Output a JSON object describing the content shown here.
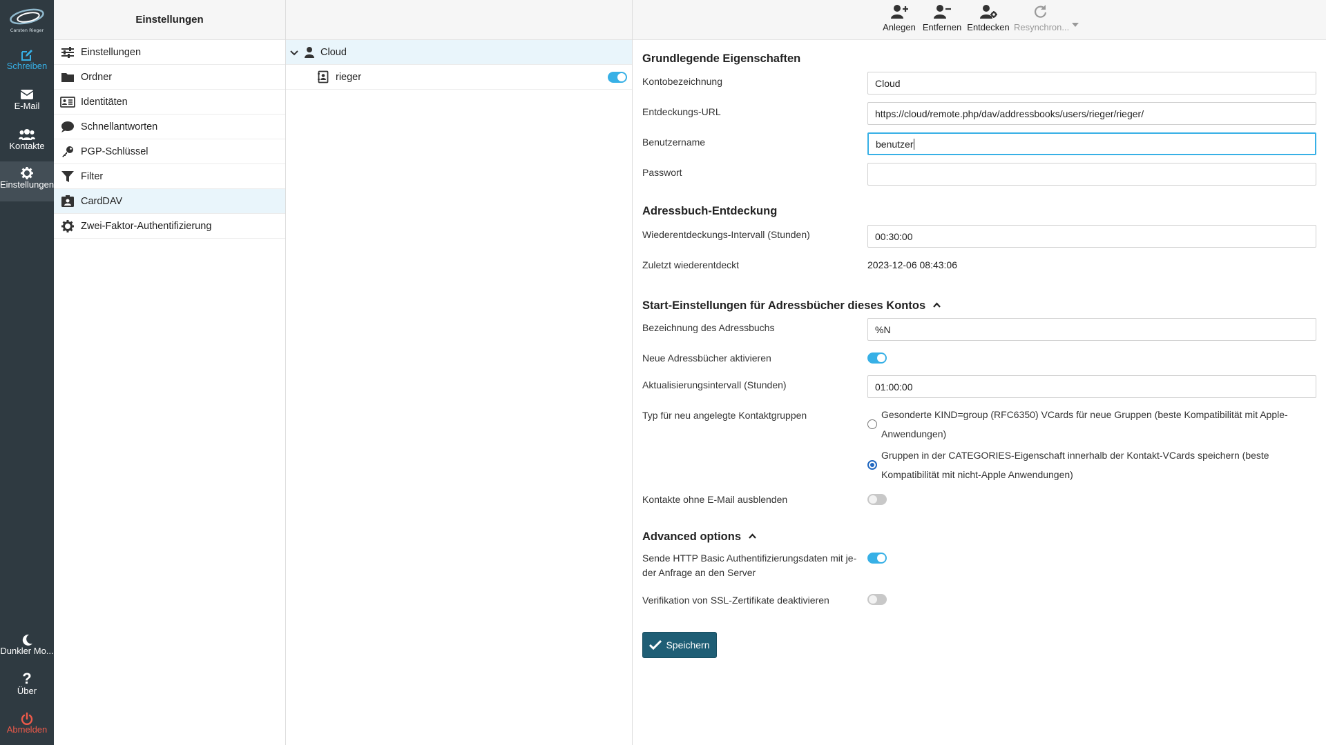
{
  "rail": {
    "logo_text": "Carsten Rieger",
    "compose": "Schreiben",
    "mail": "E-Mail",
    "contacts": "Kontakte",
    "settings": "Einstellungen",
    "dark_mode": "Dunkler Mo...",
    "about": "Über",
    "logout": "Abmelden"
  },
  "settings_nav": {
    "title": "Einstellungen",
    "items": [
      {
        "label": "Einstellungen",
        "icon": "sliders-icon"
      },
      {
        "label": "Ordner",
        "icon": "folder-icon"
      },
      {
        "label": "Identitäten",
        "icon": "id-card-icon"
      },
      {
        "label": "Schnellantworten",
        "icon": "speech-bubble-icon"
      },
      {
        "label": "PGP-Schlüssel",
        "icon": "key-icon"
      },
      {
        "label": "Filter",
        "icon": "filter-icon"
      },
      {
        "label": "CardDAV",
        "icon": "contact-card-icon"
      },
      {
        "label": "Zwei-Faktor-Authentifizierung",
        "icon": "gear-icon"
      }
    ],
    "selected": "CardDAV"
  },
  "accounts": {
    "account_name": "Cloud",
    "addressbook_name": "rieger",
    "addressbook_enabled": true
  },
  "toolbar": {
    "create": "Anlegen",
    "remove": "Entfernen",
    "discover": "Entdecken",
    "resync": "Resynchron..."
  },
  "form": {
    "basic_title": "Grundlegende Eigenschaften",
    "account_label": "Kontobezeichnung",
    "account_value": "Cloud",
    "discovery_label": "Entdeckungs-URL",
    "discovery_value": "https://cloud/remote.php/dav/addressbooks/users/rieger/rieger/",
    "username_label": "Benutzername",
    "username_value": "benutzer",
    "password_label": "Passwort",
    "password_value": "",
    "discovery_title": "Adressbuch-Entdeckung",
    "rediscover_label": "Wiederentdeckungs-Intervall (Stunden)",
    "rediscover_value": "00:30:00",
    "last_label": "Zuletzt wiederentdeckt",
    "last_value": "2023-12-06 08:43:06",
    "startup_title": "Start-Einstellungen für Adressbücher dieses Kontos",
    "ab_name_label": "Bezeichnung des Adressbuchs",
    "ab_name_value": "%N",
    "activate_label": "Neue Adressbücher aktivieren",
    "activate_on": true,
    "refresh_label": "Aktualisierungsintervall (Stunden)",
    "refresh_value": "01:00:00",
    "group_type_label": "Typ für neu angelegte Kontaktgruppen",
    "group_opt1": "Gesonderte KIND=group (RFC6350) VCards für neue Gruppen (beste Kompatibilität mit Apple-Anwendungen)",
    "group_opt2": "Gruppen in der CATEGORIES-Eigenschaft innerhalb der Kontakt-VCards speichern (beste Kompatibilität mit nicht-Apple Anwendungen)",
    "group_selected": 2,
    "hide_label": "Kontakte ohne E-Mail ausblenden",
    "hide_on": false,
    "advanced_title": "Advanced options",
    "basic_auth_label": "Sende HTTP Basic Authentifizierungsdaten mit je-der Anfrage an den Server",
    "basic_auth_on": true,
    "ssl_label": "Verifikation von SSL-Zertifikate deaktivieren",
    "ssl_on": false,
    "save": "Speichern"
  },
  "colors": {
    "rail_bg": "#2f3a41",
    "accent": "#37b0e6",
    "save_bg": "#1f5e75",
    "logout": "#ee5a4a"
  }
}
